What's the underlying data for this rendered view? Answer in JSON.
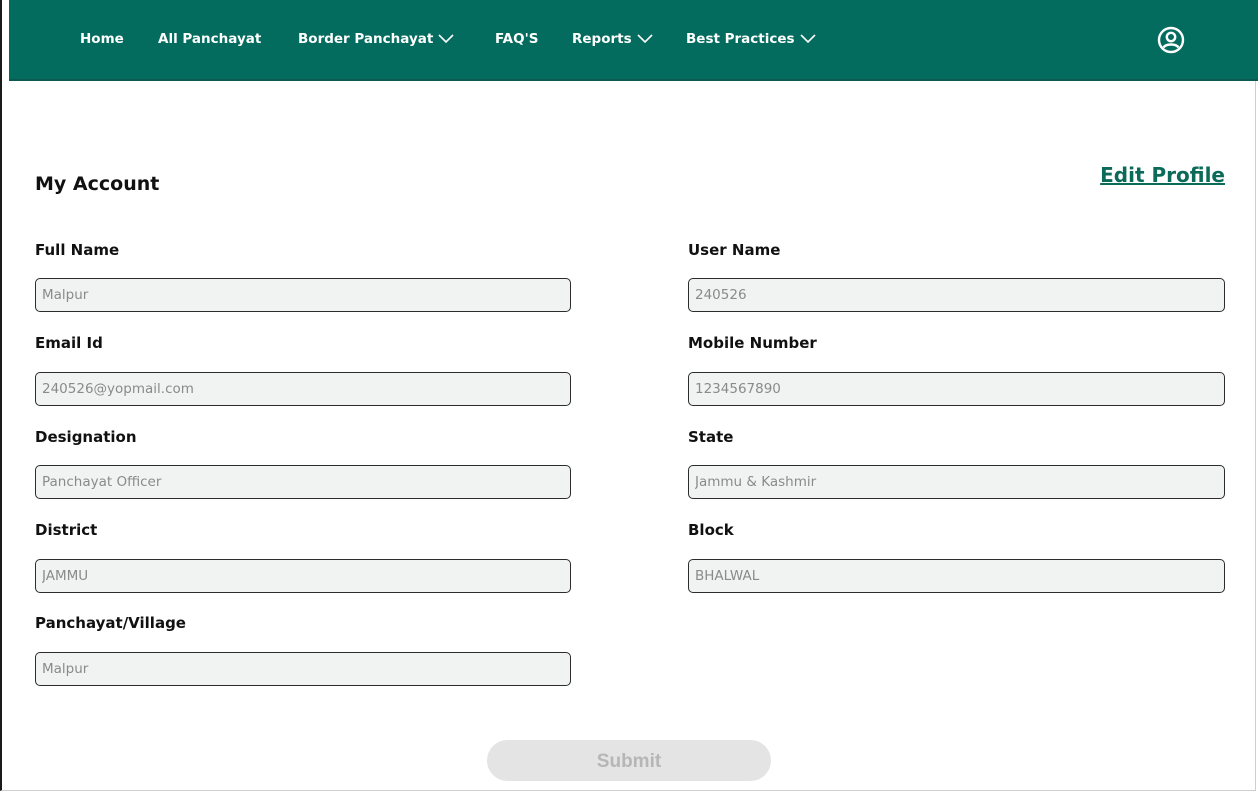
{
  "nav": {
    "items": [
      {
        "label": "Home",
        "dropdown": false
      },
      {
        "label": "All Panchayat",
        "dropdown": false
      },
      {
        "label": "Border Panchayat",
        "dropdown": true
      },
      {
        "label": "FAQ'S",
        "dropdown": false
      },
      {
        "label": "Reports",
        "dropdown": true
      },
      {
        "label": "Best Practices",
        "dropdown": true
      }
    ],
    "user_icon": "user-circle-icon",
    "bg_color": "#036c5f"
  },
  "page": {
    "title": "My Account",
    "edit_link": "Edit Profile"
  },
  "form": {
    "full_name": {
      "label": "Full Name",
      "value": "Malpur"
    },
    "user_name": {
      "label": "User Name",
      "value": "240526"
    },
    "email": {
      "label": "Email Id",
      "value": "240526@yopmail.com"
    },
    "mobile": {
      "label": "Mobile Number",
      "value": "1234567890"
    },
    "designation": {
      "label": "Designation",
      "value": "Panchayat Officer"
    },
    "state": {
      "label": "State",
      "value": "Jammu & Kashmir"
    },
    "district": {
      "label": "District",
      "value": "JAMMU"
    },
    "block": {
      "label": "Block",
      "value": "BHALWAL"
    },
    "panchayat": {
      "label": "Panchayat/Village",
      "value": "Malpur"
    },
    "submit_label": "Submit"
  }
}
